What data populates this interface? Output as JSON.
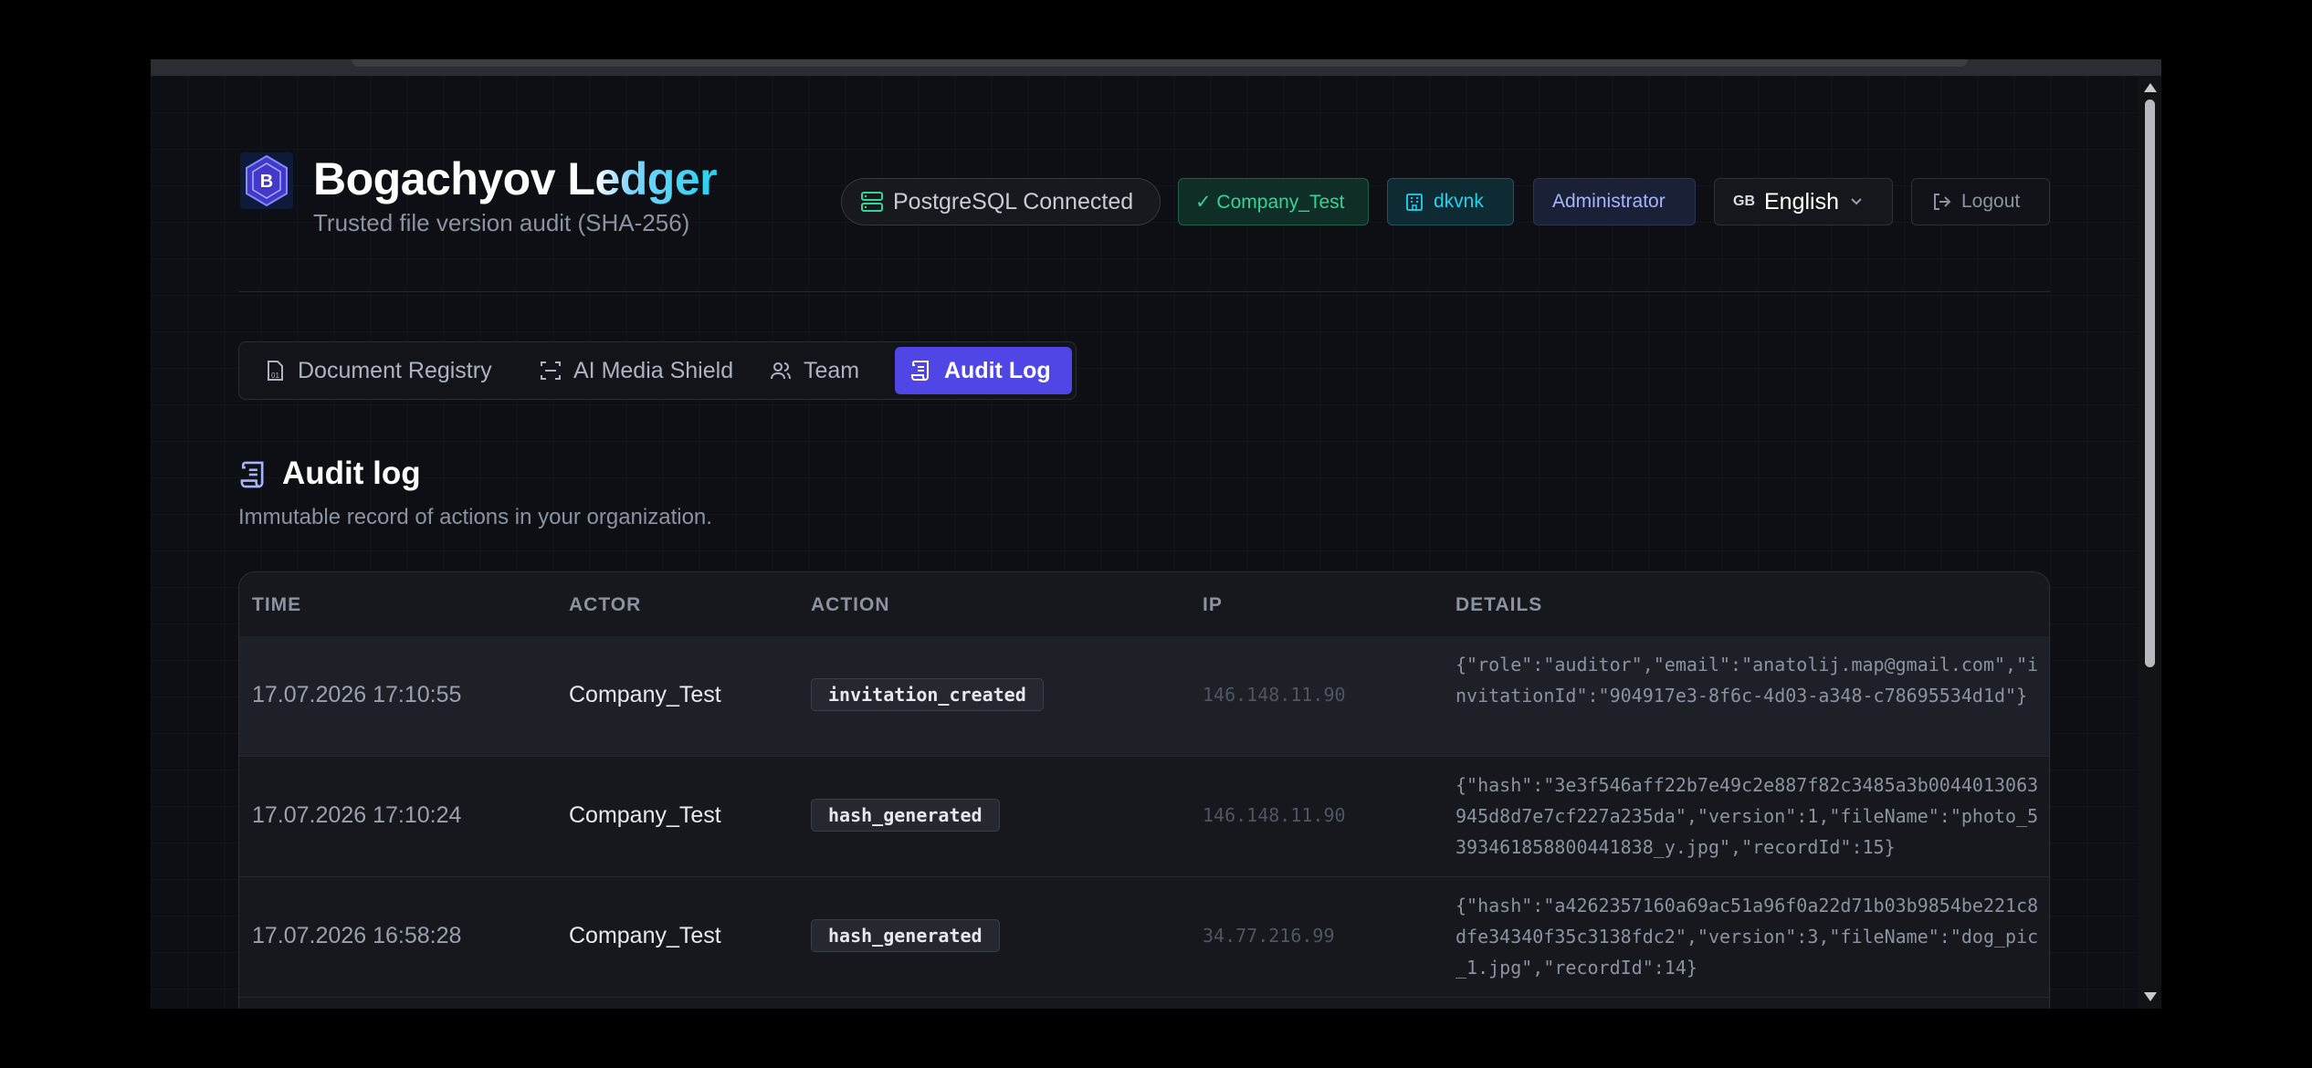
{
  "brand": {
    "title_part1": "Bogachyov L",
    "title_part2": "edger",
    "subtitle": "Trusted file version audit (SHA-256)",
    "logo_letter": "B"
  },
  "header": {
    "db_status": "PostgreSQL Connected",
    "company": "✓ Company_Test",
    "user": "dkvnk",
    "role": "Administrator",
    "lang_code": "GB",
    "language": "English",
    "logout": "Logout"
  },
  "tabs": [
    {
      "label": "Document Registry",
      "active": false
    },
    {
      "label": "AI Media Shield",
      "active": false
    },
    {
      "label": "Team",
      "active": false
    },
    {
      "label": "Audit Log",
      "active": true
    }
  ],
  "section": {
    "title": "Audit log",
    "subtitle": "Immutable record of actions in your organization."
  },
  "table": {
    "columns": [
      "TIME",
      "ACTOR",
      "ACTION",
      "IP",
      "DETAILS"
    ],
    "rows": [
      {
        "time": "17.07.2026 17:10:55",
        "actor": "Company_Test",
        "action": "invitation_created",
        "ip": "146.148.11.90",
        "details": "{\"role\":\"auditor\",\"email\":\"anatolij.map@gmail.com\",\"invitationId\":\"904917e3-8f6c-4d03-a348-c78695534d1d\"}"
      },
      {
        "time": "17.07.2026 17:10:24",
        "actor": "Company_Test",
        "action": "hash_generated",
        "ip": "146.148.11.90",
        "details": "{\"hash\":\"3e3f546aff22b7e49c2e887f82c3485a3b0044013063945d8d7e7cf227a235da\",\"version\":1,\"fileName\":\"photo_5393461858800441838_y.jpg\",\"recordId\":15}"
      },
      {
        "time": "17.07.2026 16:58:28",
        "actor": "Company_Test",
        "action": "hash_generated",
        "ip": "34.77.216.99",
        "details": "{\"hash\":\"a4262357160a69ac51a96f0a22d71b03b9854be221c8dfe34340f35c3138fdc2\",\"version\":3,\"fileName\":\"dog_pic_1.jpg\",\"recordId\":14}"
      }
    ]
  },
  "colors": {
    "accent": "#4f46e5",
    "success": "#34d399",
    "cyan": "#22d3ee",
    "background": "#0d0f14"
  }
}
